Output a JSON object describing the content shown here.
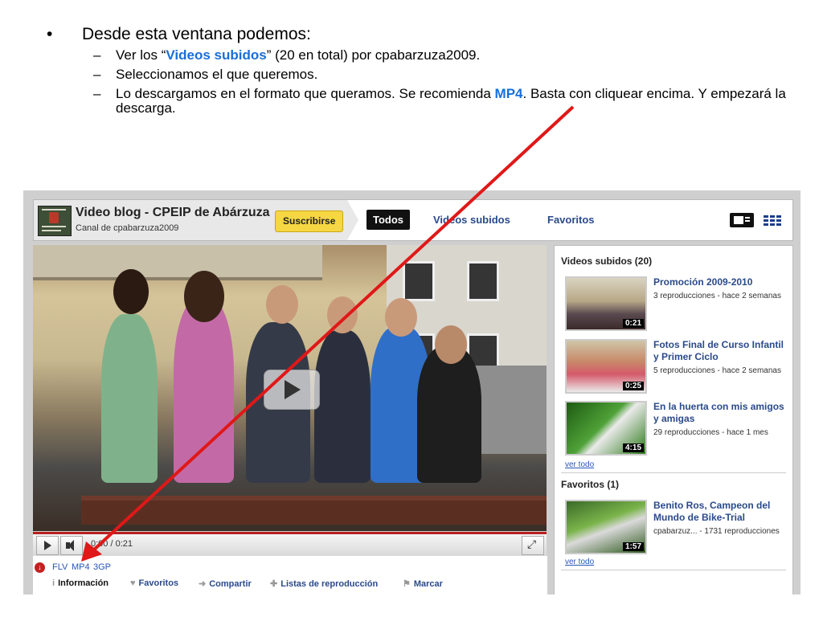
{
  "slide": {
    "bullet_marker": "•",
    "dash_marker": "–",
    "intro": "Desde esta ventana podemos:",
    "item1": {
      "pre": "Ver los “",
      "highlight": "Videos subidos",
      "post": "” (20 en total) por cpabarzuza2009."
    },
    "item2": "Seleccionamos el que queremos.",
    "item3": {
      "pre": "Lo descargamos en el formato que queramos. Se recomienda ",
      "highlight": "MP4",
      "post": ". Basta con cliquear encima. Y empezará la descarga."
    }
  },
  "channel": {
    "title": "Video blog - CPEIP de Abárzuza",
    "subtitle": "Canal de cpabarzuza2009",
    "subscribe_label": "Suscribirse",
    "tabs": [
      "Todos",
      "Videos subidos",
      "Favoritos"
    ]
  },
  "player": {
    "time": "0:00 / 0:21",
    "formats": [
      "FLV",
      "MP4",
      "3GP"
    ],
    "info_tabs": [
      "Información",
      "Favoritos",
      "Compartir",
      "Listas de reproducción",
      "Marcar"
    ]
  },
  "sidebar": {
    "uploaded_title": "Videos subidos (20)",
    "uploaded": [
      {
        "title": "Promoción 2009-2010",
        "meta": "3 reproducciones - hace 2 semanas",
        "duration": "0:21"
      },
      {
        "title": "Fotos Final de Curso Infantil y Primer Ciclo",
        "meta": "5 reproducciones - hace 2 semanas",
        "duration": "0:25"
      },
      {
        "title": "En la huerta con mis amigos y amigas",
        "meta": "29 reproducciones - hace 1 mes",
        "duration": "4:15"
      }
    ],
    "see_all": "ver todo",
    "favorites_title": "Favoritos (1)",
    "favorites": [
      {
        "title": "Benito Ros, Campeon del Mundo de Bike-Trial",
        "meta": "cpabarzuz... - 1731 reproducciones",
        "duration": "1:57"
      }
    ],
    "see_all_2": "ver todo"
  },
  "colors": {
    "highlight": "#1a6ed8",
    "arrow": "#e01818",
    "subscribe": "#f6d642"
  }
}
